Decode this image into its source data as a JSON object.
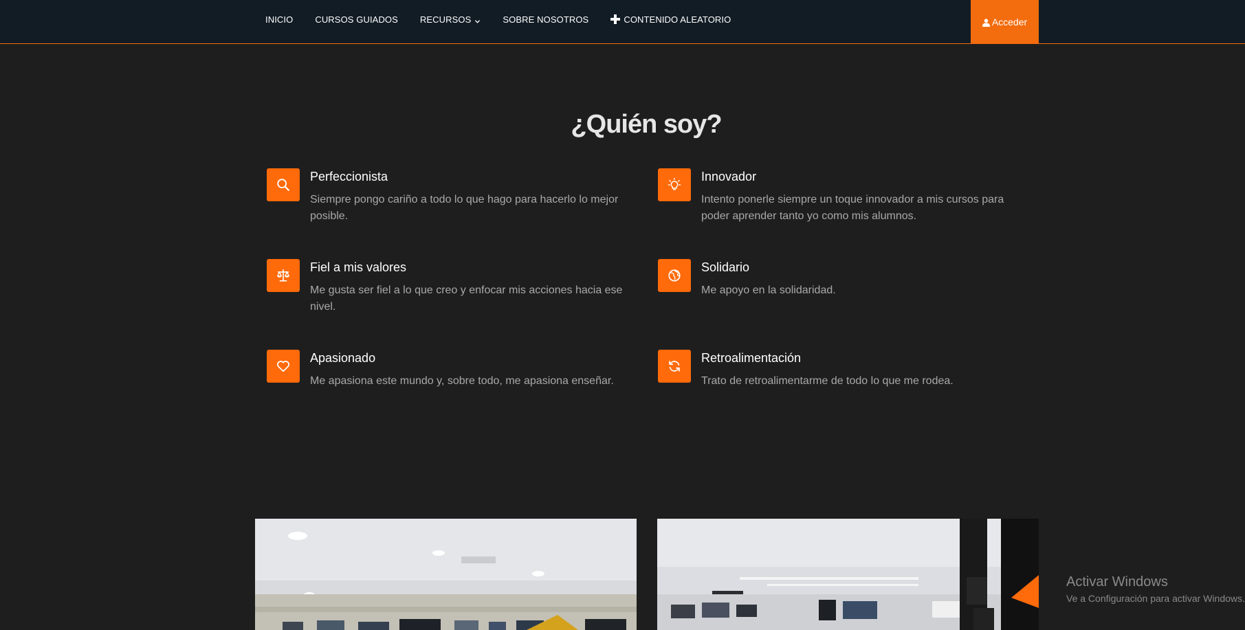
{
  "nav": {
    "items": [
      {
        "label": "INICIO"
      },
      {
        "label": "CURSOS GUIADOS"
      },
      {
        "label": "RECURSOS"
      },
      {
        "label": "SOBRE NOSOTROS"
      },
      {
        "label": "CONTENIDO ALEATORIO"
      }
    ],
    "login_label": "Acceder"
  },
  "section": {
    "title": "¿Quién soy?"
  },
  "features": [
    {
      "icon": "search-icon",
      "title": "Perfeccionista",
      "description": "Siempre pongo cariño a todo lo que hago para hacerlo lo mejor posible."
    },
    {
      "icon": "lightbulb-icon",
      "title": "Innovador",
      "description": "Intento ponerle siempre un toque innovador a mis cursos para poder aprender tanto yo como mis alumnos."
    },
    {
      "icon": "balance-scale-icon",
      "title": "Fiel a mis valores",
      "description": "Me gusta ser fiel a lo que creo y enfocar mis acciones hacia ese nivel."
    },
    {
      "icon": "globe-icon",
      "title": "Solidario",
      "description": "Me apoyo en la solidaridad."
    },
    {
      "icon": "heart-icon",
      "title": "Apasionado",
      "description": "Me apasiona este mundo y, sobre todo, me apasiona enseñar."
    },
    {
      "icon": "refresh-icon",
      "title": "Retroalimentación",
      "description": "Trato de retroalimentarme de todo lo que me rodea."
    }
  ],
  "colors": {
    "accent": "#ff6a0a",
    "nav_background": "#121c25",
    "page_background": "#1e1e1e"
  },
  "watermark": {
    "title": "Activar Windows",
    "subtitle": "Ve a Configuración para activar Windows."
  }
}
